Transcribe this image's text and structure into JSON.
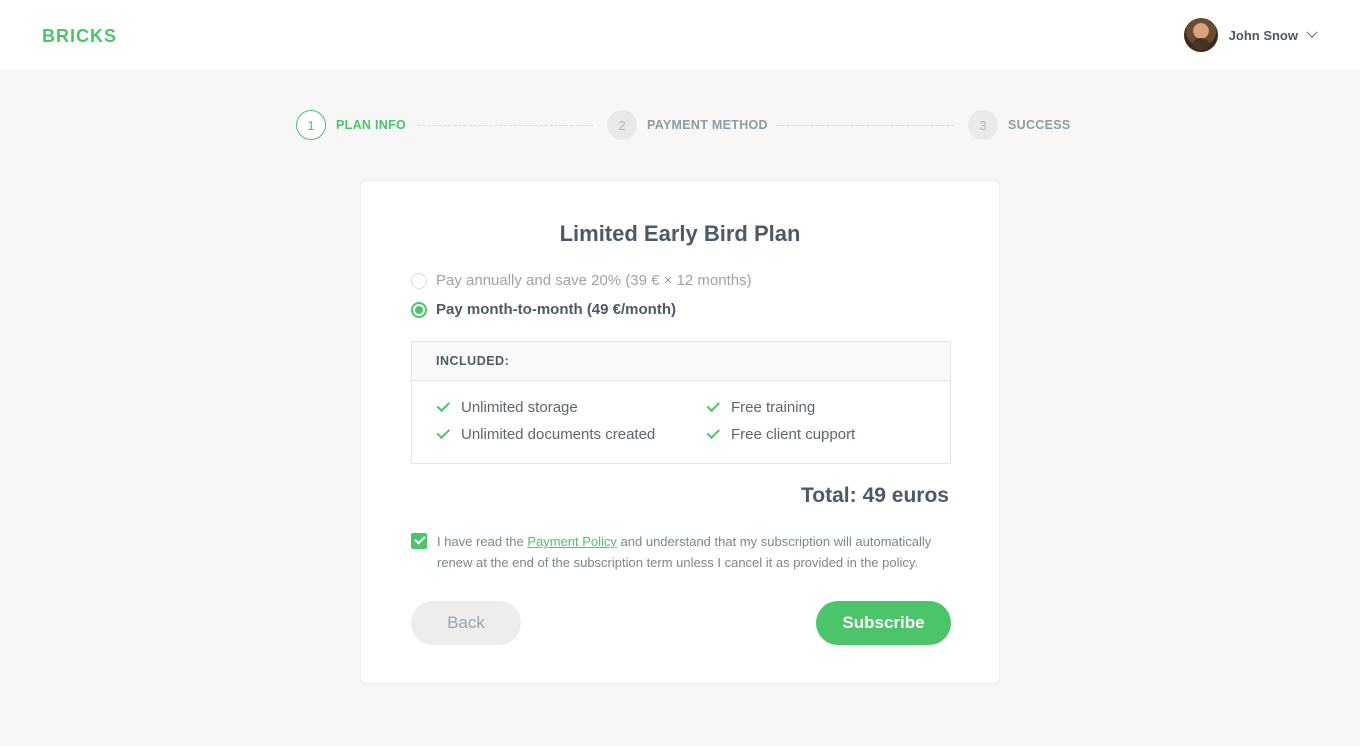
{
  "header": {
    "logo": "BRICKS",
    "user_name": "John Snow"
  },
  "stepper": [
    {
      "number": "1",
      "label": "PLAN INFO",
      "state": "active"
    },
    {
      "number": "2",
      "label": "PAYMENT METHOD",
      "state": "inactive"
    },
    {
      "number": "3",
      "label": "SUCCESS",
      "state": "inactive"
    }
  ],
  "plan": {
    "title": "Limited Early Bird Plan",
    "options": [
      {
        "label": "Pay annually and save 20% (39 € × 12 months)",
        "selected": false
      },
      {
        "label": "Pay month-to-month (49 €/month)",
        "selected": true
      }
    ],
    "included_heading": "INCLUDED:",
    "features": [
      "Unlimited storage",
      "Unlimited documents created",
      "Free training",
      "Free client cupport"
    ],
    "total_label": "Total:",
    "total_amount": "49 euros"
  },
  "agreement": {
    "checked": true,
    "text_before": "I have read the ",
    "link": "Payment Policy",
    "text_after": " and understand that my subscription will automatically renew at the end of the subscription term unless I cancel it as provided in the policy."
  },
  "buttons": {
    "back": "Back",
    "subscribe": "Subscribe"
  },
  "colors": {
    "accent": "#4cc46a",
    "text": "#4b5a66",
    "background": "#f7f7f7"
  }
}
